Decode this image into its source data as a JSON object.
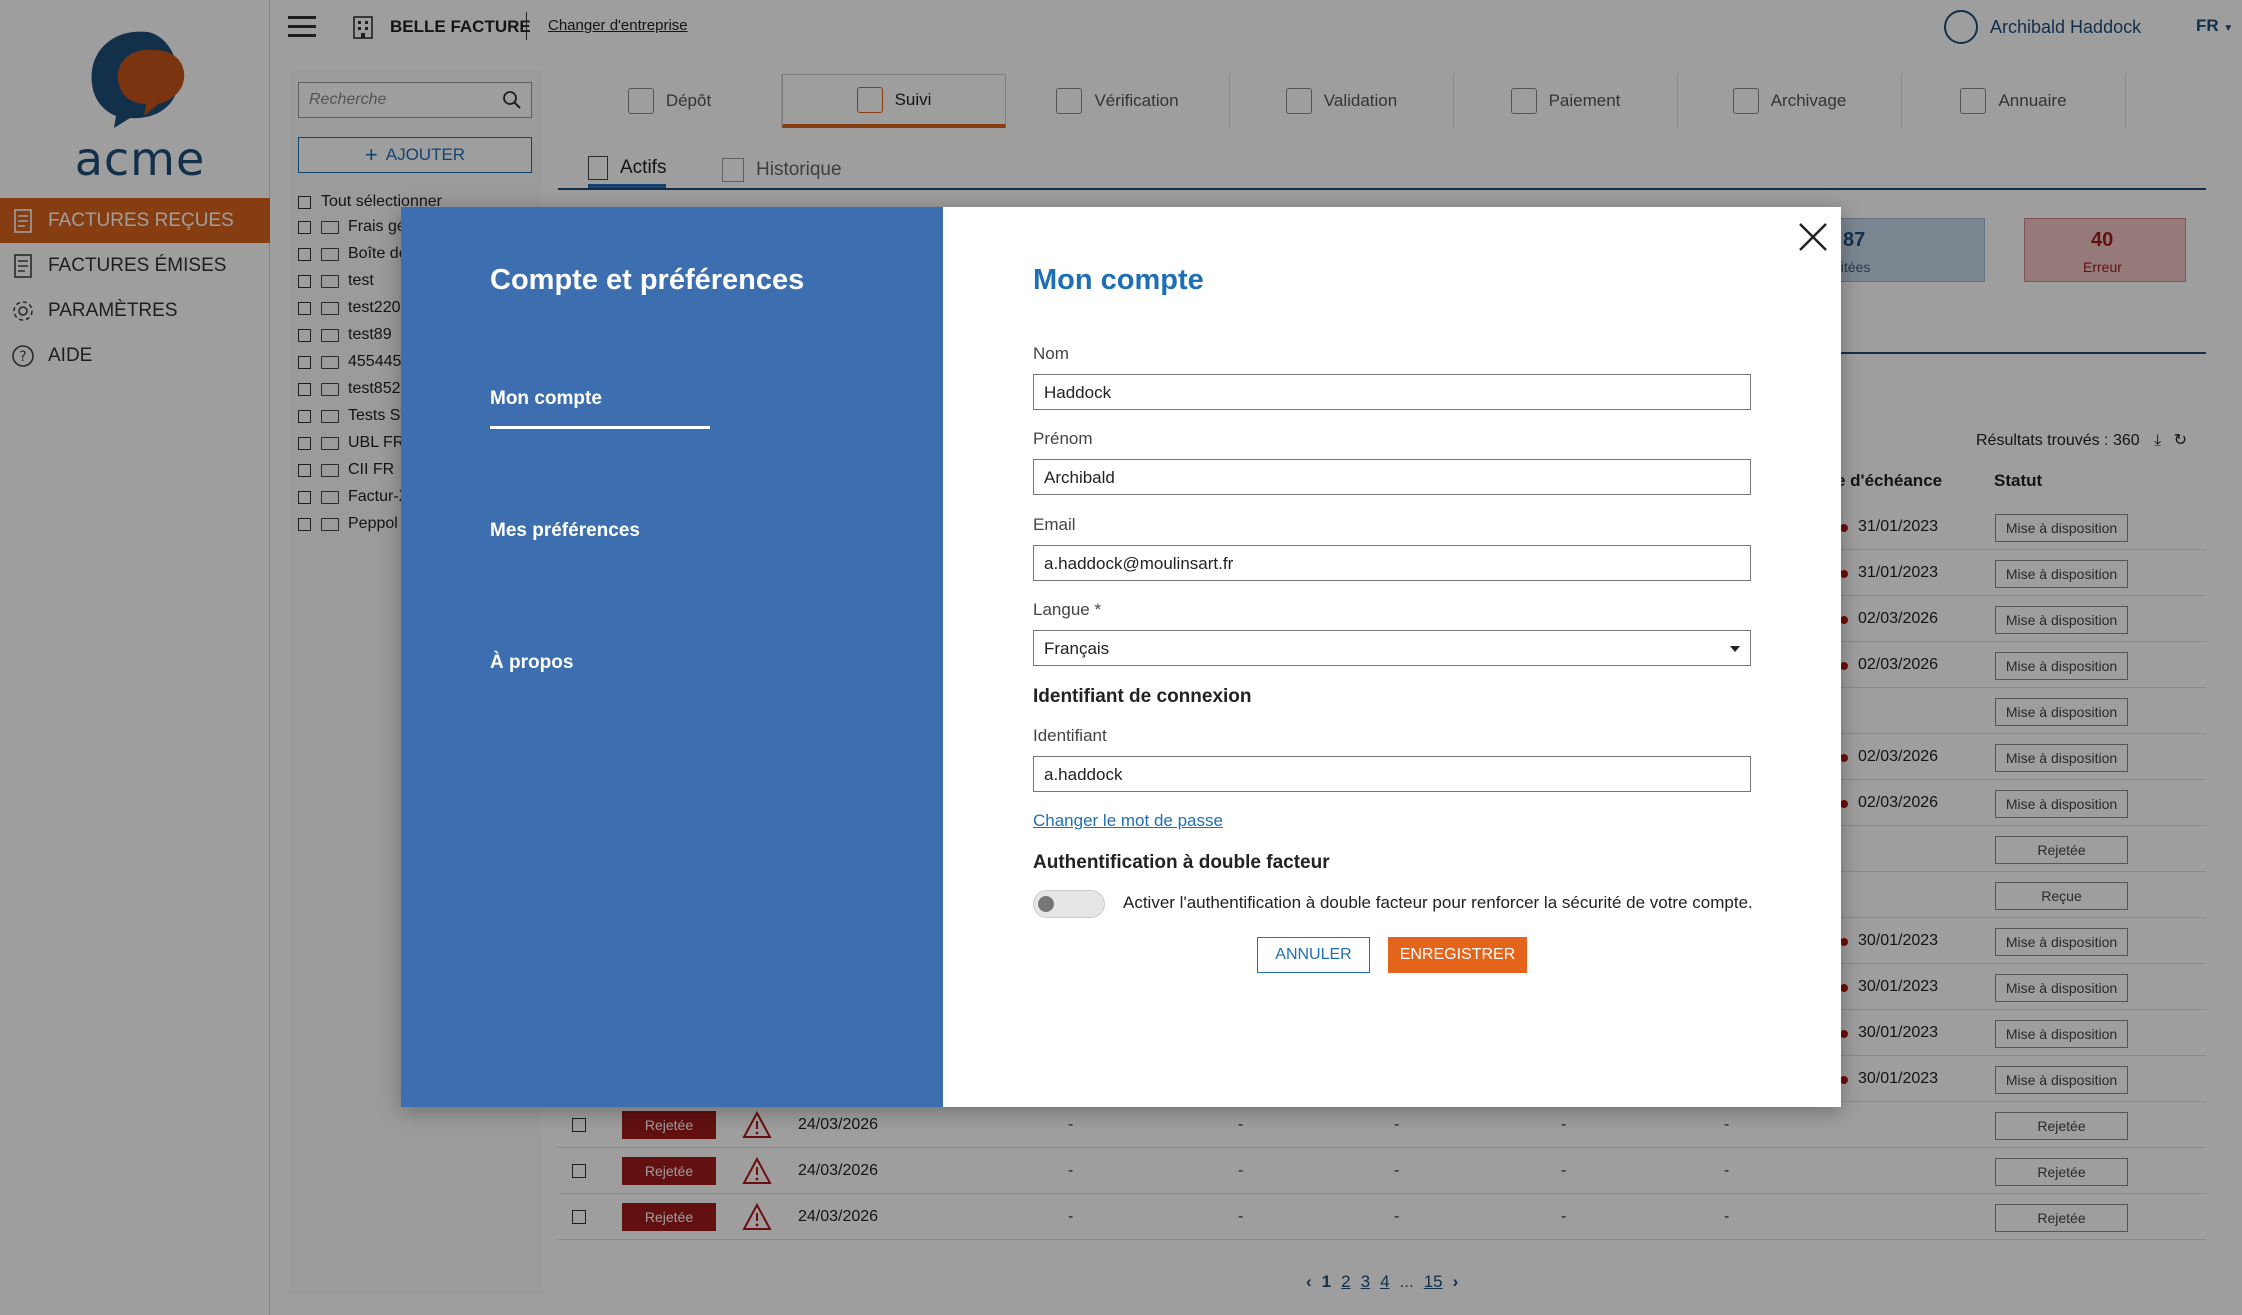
{
  "brand": {
    "logo_text": "acme"
  },
  "sidebar": {
    "items": [
      {
        "label": "FACTURES REÇUES",
        "icon": "invoice-received-icon",
        "active": true
      },
      {
        "label": "FACTURES ÉMISES",
        "icon": "invoice-issued-icon",
        "active": false
      },
      {
        "label": "PARAMÈTRES",
        "icon": "gear-icon",
        "active": false
      },
      {
        "label": "AIDE",
        "icon": "help-icon",
        "active": false
      }
    ]
  },
  "topbar": {
    "company": "BELLE FACTURE",
    "change_company": "Changer d'entreprise",
    "user": "Archibald Haddock",
    "language": "FR"
  },
  "filters": {
    "search_placeholder": "Recherche",
    "add_label": "AJOUTER",
    "select_all": "Tout sélectionner",
    "folders": [
      "Frais gé",
      "Boîte de",
      "test",
      "test220",
      "test89",
      "455445",
      "test852",
      "Tests ST",
      "UBL FR",
      "CII FR",
      "Factur-X",
      "Peppol"
    ]
  },
  "main_tabs": [
    {
      "label": "Dépôt",
      "active": false
    },
    {
      "label": "Suivi",
      "active": true
    },
    {
      "label": "Vérification",
      "active": false
    },
    {
      "label": "Validation",
      "active": false
    },
    {
      "label": "Paiement",
      "active": false
    },
    {
      "label": "Archivage",
      "active": false
    },
    {
      "label": "Annuaire",
      "active": false
    }
  ],
  "sub_tabs": [
    {
      "label": "Actifs",
      "active": true
    },
    {
      "label": "Historique",
      "active": false
    }
  ],
  "stats": [
    {
      "value": "87",
      "label": "aitées"
    },
    {
      "value": "40",
      "label": "Erreur"
    }
  ],
  "table": {
    "results": "Résultats trouvés : 360",
    "col_due": "e d'échéance",
    "col_status": "Statut",
    "rows": [
      {
        "due": "31/01/2023",
        "status": "Mise à disposition",
        "dot": true
      },
      {
        "due": "31/01/2023",
        "status": "Mise à disposition",
        "dot": true
      },
      {
        "due": "02/03/2026",
        "status": "Mise à disposition",
        "dot": true
      },
      {
        "due": "02/03/2026",
        "status": "Mise à disposition",
        "dot": true
      },
      {
        "due": "",
        "status": "Mise à disposition",
        "dot": false
      },
      {
        "due": "02/03/2026",
        "status": "Mise à disposition",
        "dot": true
      },
      {
        "due": "02/03/2026",
        "status": "Mise à disposition",
        "dot": true
      },
      {
        "due": "",
        "status": "Rejetée",
        "dot": false
      },
      {
        "due": "",
        "status": "Reçue",
        "dot": false
      },
      {
        "due": "30/01/2023",
        "status": "Mise à disposition",
        "dot": true
      },
      {
        "due": "30/01/2023",
        "status": "Mise à disposition",
        "dot": true
      },
      {
        "due": "30/01/2023",
        "status": "Mise à disposition",
        "dot": true
      },
      {
        "due": "30/01/2023",
        "status": "Mise à disposition",
        "dot": true
      }
    ],
    "lower_rows": [
      {
        "badge": "Rejetée",
        "date": "24/03/2026",
        "status": "Rejetée"
      },
      {
        "badge": "Rejetée",
        "date": "24/03/2026",
        "status": "Rejetée"
      },
      {
        "badge": "Rejetée",
        "date": "24/03/2026",
        "status": "Rejetée"
      }
    ],
    "dash": "-"
  },
  "pagination": {
    "pages": [
      "1",
      "2",
      "3",
      "4"
    ],
    "ellipsis": "...",
    "last": "15",
    "current": "1"
  },
  "modal": {
    "title": "Compte et préférences",
    "nav": [
      "Mon compte",
      "Mes préférences",
      "À propos"
    ],
    "section_title": "Mon compte",
    "fields": {
      "nom_label": "Nom",
      "nom_value": "Haddock",
      "prenom_label": "Prénom",
      "prenom_value": "Archibald",
      "email_label": "Email",
      "email_value": "a.haddock@moulinsart.fr",
      "langue_label": "Langue *",
      "langue_value": "Français"
    },
    "login_heading": "Identifiant de connexion",
    "login_label": "Identifiant",
    "login_value": "a.haddock",
    "change_password": "Changer le mot de passe",
    "twofa_heading": "Authentification à double facteur",
    "twofa_text": "Activer l'authentification à double facteur pour renforcer la sécurité de votre compte.",
    "twofa_enabled": false,
    "cancel": "ANNULER",
    "save": "ENREGISTRER"
  },
  "colors": {
    "accent": "#d9631e",
    "brand_blue": "#1f4e79",
    "modal_panel": "#3d6fb0",
    "link": "#1f6fb5",
    "reject": "#9e1b1b"
  }
}
